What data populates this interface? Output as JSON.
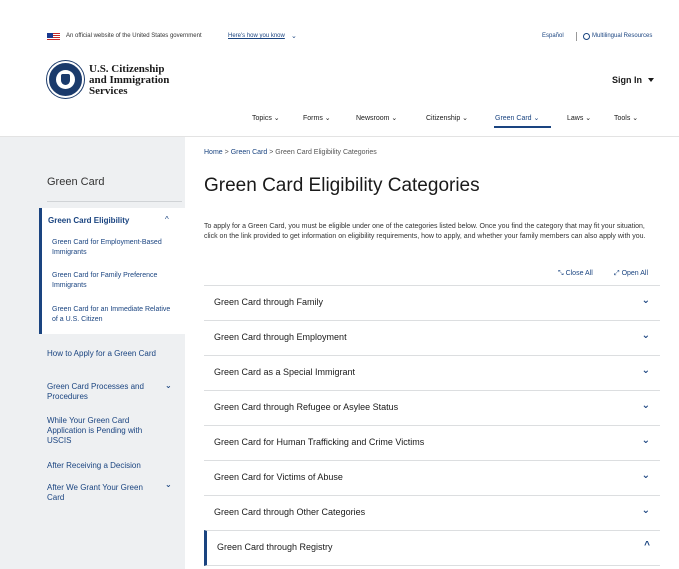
{
  "gov_banner": {
    "text": "An official website of the United States government",
    "link": "Here's how you know",
    "espanol": "Español",
    "multilingual": "Multilingual Resources"
  },
  "header": {
    "agency_line1": "U.S. Citizenship",
    "agency_line2": "and Immigration",
    "agency_line3": "Services",
    "sign_in": "Sign In"
  },
  "nav": {
    "items": [
      {
        "label": "Topics ⌄"
      },
      {
        "label": "Forms ⌄"
      },
      {
        "label": "Newsroom ⌄"
      },
      {
        "label": "Citizenship ⌄"
      },
      {
        "label": "Green Card ⌄"
      },
      {
        "label": "Laws ⌄"
      },
      {
        "label": "Tools ⌄"
      }
    ]
  },
  "sidebar": {
    "title": "Green Card",
    "active_section": "Green Card Eligibility",
    "sub_items": [
      {
        "label": "Green Card for Employment-Based Immigrants"
      },
      {
        "label": "Green Card for Family Preference Immigrants"
      },
      {
        "label": "Green Card for an Immediate Relative of a U.S. Citizen"
      }
    ],
    "items": [
      {
        "label": "How to Apply for a Green Card"
      },
      {
        "label": "Green Card Processes and Procedures"
      },
      {
        "label": "While Your Green Card Application is Pending with USCIS"
      },
      {
        "label": "After Receiving a Decision"
      },
      {
        "label": "After We Grant Your Green Card"
      }
    ]
  },
  "breadcrumb": {
    "home": "Home",
    "green_card": "Green Card",
    "current": "Green Card Eligibility Categories",
    "sep": ">"
  },
  "main": {
    "title": "Green Card Eligibility Categories",
    "intro": "To apply for a Green Card, you must be eligible under one of the categories listed below. Once you find the category that may fit your situation, click on the link provided to get information on eligibility requirements, how to apply, and whether your family members can also apply with you.",
    "close_all": "Close All",
    "open_all": "Open All",
    "accordion": [
      {
        "label": "Green Card through Family"
      },
      {
        "label": "Green Card through Employment"
      },
      {
        "label": "Green Card as a Special Immigrant"
      },
      {
        "label": "Green Card through Refugee or Asylee Status"
      },
      {
        "label": "Green Card for Human Trafficking and Crime Victims"
      },
      {
        "label": "Green Card for Victims of Abuse"
      },
      {
        "label": "Green Card through Other Categories"
      },
      {
        "label": "Green Card through Registry"
      }
    ]
  },
  "colors": {
    "primary": "#1a4480",
    "sidebar_bg": "#eef0f2"
  }
}
